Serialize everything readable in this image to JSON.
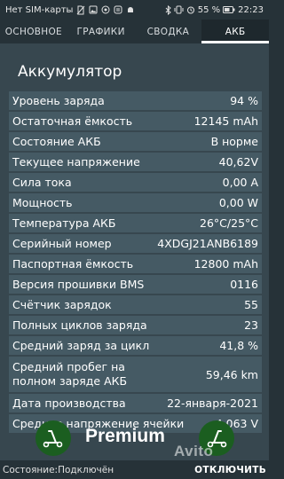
{
  "status_bar": {
    "carrier": "Нет SIM-карты",
    "battery_percent": "55 %",
    "time": "22:23"
  },
  "tabs": [
    {
      "label": "ОСНОВНОЕ",
      "active": false
    },
    {
      "label": "ГРАФИКИ",
      "active": false
    },
    {
      "label": "СВОДКА",
      "active": false
    },
    {
      "label": "АКБ",
      "active": true
    }
  ],
  "section": {
    "title": "Аккумулятор",
    "rows": [
      {
        "label": "Уровень заряда",
        "value": "94 %"
      },
      {
        "label": "Остаточная ёмкость",
        "value": "12145 mAh"
      },
      {
        "label": "Состояние АКБ",
        "value": "В норме"
      },
      {
        "label": "Текущее напряжение",
        "value": "40,62V"
      },
      {
        "label": "Сила тока",
        "value": "0,00 A"
      },
      {
        "label": "Мощность",
        "value": "0,00 W"
      },
      {
        "label": "Температура АКБ",
        "value": "26°C/25°C"
      },
      {
        "label": "Серийный номер",
        "value": "4XDGJ21ANB6189"
      },
      {
        "label": "Паспортная ёмкость",
        "value": "12800 mAh"
      },
      {
        "label": "Версия прошивки BMS",
        "value": "0116"
      },
      {
        "label": "Счётчик зарядок",
        "value": "55"
      },
      {
        "label": "Полных циклов заряда",
        "value": "23"
      },
      {
        "label": "Средний заряд за цикл",
        "value": "41,8 %"
      },
      {
        "label": "Средний пробег на полном заряде АКБ",
        "value": "59,46 km"
      },
      {
        "label": "Дата производства",
        "value": "22-января-2021"
      },
      {
        "label": "Среднее напряжение ячейки",
        "value": "4,063 V"
      }
    ]
  },
  "premium": {
    "label": "Premium"
  },
  "watermark": {
    "text": "Avito"
  },
  "bottom": {
    "status": "Состояние:Подключён",
    "disconnect_label": "ОТКЛЮЧИТЬ"
  },
  "icons": {
    "sim": "no-sim-icon",
    "notifications": [
      "photo-icon",
      "gallery-icon",
      "settings-app-icon",
      "android-icon"
    ],
    "right": [
      "bluetooth-icon",
      "vibrate-icon",
      "alarm-icon",
      "battery-icon"
    ],
    "premium": "kick-scooter-icon"
  },
  "colors": {
    "background": "#37474f",
    "row": "#455a64",
    "bar": "#263238",
    "premium_circle": "#1b5e20"
  }
}
